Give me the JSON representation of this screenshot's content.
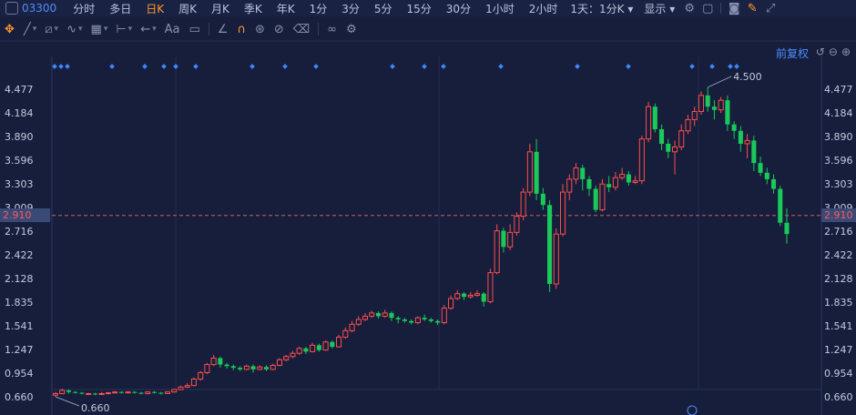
{
  "topbar": {
    "code": "03300",
    "tabs": [
      "分时",
      "多日",
      "日K",
      "周K",
      "月K",
      "季K",
      "年K",
      "1分",
      "3分",
      "5分",
      "15分",
      "30分",
      "1小时",
      "2小时"
    ],
    "active_tab": "日K",
    "dropdown_period": "1天：1分K",
    "dropdown_display": "显示"
  },
  "toolbar": {
    "tools": [
      "crosshair-icon",
      "line-icon",
      "channel-icon",
      "wave-icon",
      "fibonacci-icon",
      "range-icon",
      "arrow-icon",
      "text-icon",
      "comment-icon",
      "ruler-icon",
      "magnet-icon",
      "lock-icon",
      "hide-icon",
      "delete-icon",
      "link-icon",
      "settings-icon"
    ],
    "text_tool_label": "Aa"
  },
  "fuquan_label": "前复权",
  "current_price_label": "2.910",
  "chart_data": {
    "type": "candlestick",
    "y_ticks": [
      "4.477",
      "4.184",
      "3.890",
      "3.596",
      "3.303",
      "3.009",
      "2.716",
      "2.422",
      "2.128",
      "1.835",
      "1.541",
      "1.247",
      "0.954",
      "0.660"
    ],
    "ylim": [
      0.66,
      4.5
    ],
    "current_price": 2.91,
    "annotations": [
      {
        "label": "4.500",
        "value": 4.5
      },
      {
        "label": "0.660",
        "value": 0.66
      }
    ],
    "up_color": "#ff4d4d",
    "down_color": "#19c95a",
    "candles": [
      [
        0.68,
        0.7,
        0.72,
        0.66
      ],
      [
        0.7,
        0.74,
        0.76,
        0.69
      ],
      [
        0.74,
        0.72,
        0.75,
        0.7
      ],
      [
        0.72,
        0.71,
        0.73,
        0.7
      ],
      [
        0.71,
        0.7,
        0.72,
        0.69
      ],
      [
        0.7,
        0.7,
        0.71,
        0.68
      ],
      [
        0.7,
        0.69,
        0.71,
        0.68
      ],
      [
        0.69,
        0.7,
        0.72,
        0.68
      ],
      [
        0.7,
        0.71,
        0.72,
        0.69
      ],
      [
        0.71,
        0.72,
        0.73,
        0.7
      ],
      [
        0.72,
        0.71,
        0.73,
        0.7
      ],
      [
        0.71,
        0.72,
        0.73,
        0.7
      ],
      [
        0.72,
        0.71,
        0.73,
        0.7
      ],
      [
        0.71,
        0.7,
        0.72,
        0.69
      ],
      [
        0.7,
        0.72,
        0.73,
        0.69
      ],
      [
        0.72,
        0.71,
        0.73,
        0.7
      ],
      [
        0.71,
        0.7,
        0.72,
        0.69
      ],
      [
        0.7,
        0.72,
        0.73,
        0.7
      ],
      [
        0.72,
        0.75,
        0.76,
        0.71
      ],
      [
        0.75,
        0.78,
        0.8,
        0.74
      ],
      [
        0.78,
        0.8,
        0.83,
        0.77
      ],
      [
        0.8,
        0.88,
        0.9,
        0.79
      ],
      [
        0.88,
        0.96,
        0.98,
        0.86
      ],
      [
        0.96,
        1.06,
        1.08,
        0.94
      ],
      [
        1.06,
        1.14,
        1.18,
        1.04
      ],
      [
        1.14,
        1.06,
        1.16,
        1.02
      ],
      [
        1.06,
        1.04,
        1.08,
        1.01
      ],
      [
        1.04,
        1.02,
        1.06,
        0.99
      ],
      [
        1.02,
        1.0,
        1.04,
        0.98
      ],
      [
        1.0,
        1.04,
        1.06,
        0.99
      ],
      [
        1.04,
        1.0,
        1.06,
        0.96
      ],
      [
        1.0,
        1.03,
        1.05,
        0.99
      ],
      [
        1.03,
        1.0,
        1.05,
        0.98
      ],
      [
        1.0,
        1.05,
        1.07,
        0.99
      ],
      [
        1.05,
        1.12,
        1.14,
        1.04
      ],
      [
        1.12,
        1.16,
        1.18,
        1.1
      ],
      [
        1.16,
        1.2,
        1.23,
        1.14
      ],
      [
        1.2,
        1.26,
        1.28,
        1.18
      ],
      [
        1.26,
        1.22,
        1.28,
        1.19
      ],
      [
        1.22,
        1.3,
        1.33,
        1.21
      ],
      [
        1.3,
        1.24,
        1.32,
        1.22
      ],
      [
        1.24,
        1.34,
        1.36,
        1.23
      ],
      [
        1.34,
        1.28,
        1.36,
        1.26
      ],
      [
        1.28,
        1.4,
        1.43,
        1.27
      ],
      [
        1.4,
        1.48,
        1.52,
        1.38
      ],
      [
        1.48,
        1.56,
        1.6,
        1.46
      ],
      [
        1.56,
        1.62,
        1.66,
        1.54
      ],
      [
        1.62,
        1.66,
        1.7,
        1.6
      ],
      [
        1.66,
        1.7,
        1.73,
        1.64
      ],
      [
        1.7,
        1.66,
        1.72,
        1.63
      ],
      [
        1.66,
        1.7,
        1.74,
        1.64
      ],
      [
        1.7,
        1.64,
        1.72,
        1.6
      ],
      [
        1.64,
        1.62,
        1.66,
        1.57
      ],
      [
        1.62,
        1.6,
        1.64,
        1.58
      ],
      [
        1.6,
        1.58,
        1.62,
        1.56
      ],
      [
        1.58,
        1.64,
        1.66,
        1.56
      ],
      [
        1.64,
        1.62,
        1.68,
        1.6
      ],
      [
        1.62,
        1.6,
        1.64,
        1.58
      ],
      [
        1.6,
        1.58,
        1.62,
        1.55
      ],
      [
        1.58,
        1.76,
        1.8,
        1.56
      ],
      [
        1.76,
        1.88,
        1.92,
        1.74
      ],
      [
        1.88,
        1.94,
        1.98,
        1.86
      ],
      [
        1.94,
        1.9,
        1.96,
        1.86
      ],
      [
        1.9,
        1.92,
        1.96,
        1.88
      ],
      [
        1.92,
        1.94,
        1.98,
        1.9
      ],
      [
        1.94,
        1.84,
        1.96,
        1.78
      ],
      [
        1.84,
        2.2,
        2.25,
        1.82
      ],
      [
        2.2,
        2.72,
        2.8,
        2.18
      ],
      [
        2.72,
        2.52,
        2.76,
        2.45
      ],
      [
        2.52,
        2.7,
        2.8,
        2.48
      ],
      [
        2.7,
        2.9,
        2.95,
        2.66
      ],
      [
        2.9,
        3.2,
        3.25,
        2.85
      ],
      [
        3.2,
        3.7,
        3.8,
        3.15
      ],
      [
        3.7,
        3.18,
        3.86,
        3.1
      ],
      [
        3.18,
        3.04,
        3.25,
        2.98
      ],
      [
        3.04,
        2.06,
        3.1,
        1.96
      ],
      [
        2.06,
        2.68,
        2.75,
        2.0
      ],
      [
        2.68,
        3.2,
        3.3,
        2.65
      ],
      [
        3.2,
        3.36,
        3.42,
        3.1
      ],
      [
        3.36,
        3.5,
        3.56,
        3.3
      ],
      [
        3.5,
        3.36,
        3.54,
        3.22
      ],
      [
        3.36,
        3.24,
        3.4,
        3.15
      ],
      [
        3.24,
        2.98,
        3.28,
        2.95
      ],
      [
        2.98,
        3.3,
        3.36,
        2.96
      ],
      [
        3.3,
        3.26,
        3.4,
        3.2
      ],
      [
        3.26,
        3.38,
        3.45,
        3.22
      ],
      [
        3.38,
        3.42,
        3.5,
        3.35
      ],
      [
        3.42,
        3.32,
        3.46,
        3.28
      ],
      [
        3.32,
        3.34,
        3.4,
        3.3
      ],
      [
        3.34,
        3.86,
        3.9,
        3.3
      ],
      [
        3.86,
        4.26,
        4.32,
        3.82
      ],
      [
        4.26,
        3.98,
        4.3,
        3.94
      ],
      [
        3.98,
        3.8,
        4.04,
        3.72
      ],
      [
        3.8,
        3.7,
        3.86,
        3.62
      ],
      [
        3.7,
        3.76,
        3.84,
        3.42
      ],
      [
        3.76,
        3.96,
        4.04,
        3.72
      ],
      [
        3.96,
        4.1,
        4.16,
        3.92
      ],
      [
        4.1,
        4.2,
        4.26,
        4.02
      ],
      [
        4.2,
        4.4,
        4.45,
        4.16
      ],
      [
        4.4,
        4.26,
        4.5,
        4.2
      ],
      [
        4.26,
        4.22,
        4.34,
        4.1
      ],
      [
        4.22,
        4.34,
        4.38,
        4.18
      ],
      [
        4.34,
        4.04,
        4.4,
        3.96
      ],
      [
        4.04,
        3.96,
        4.08,
        3.86
      ],
      [
        3.96,
        3.8,
        4.02,
        3.7
      ],
      [
        3.8,
        3.84,
        3.92,
        3.62
      ],
      [
        3.84,
        3.56,
        3.9,
        3.46
      ],
      [
        3.56,
        3.44,
        3.64,
        3.4
      ],
      [
        3.44,
        3.36,
        3.5,
        3.3
      ],
      [
        3.36,
        3.24,
        3.42,
        3.18
      ],
      [
        3.24,
        2.82,
        3.28,
        2.78
      ],
      [
        2.82,
        2.68,
        3.0,
        2.56
      ]
    ]
  }
}
